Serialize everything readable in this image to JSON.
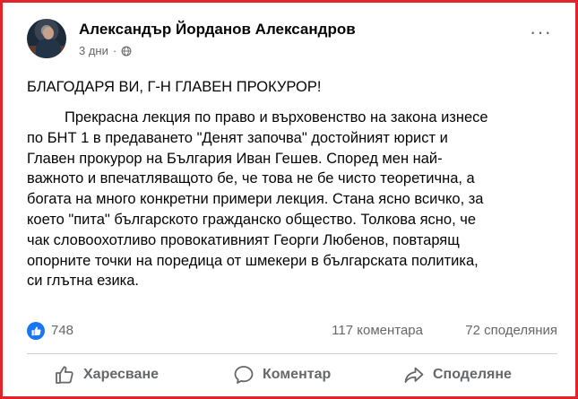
{
  "post": {
    "author": "Александър Йорданов Александров",
    "time": "3 дни",
    "separator": "·",
    "headline": "БЛАГОДАРЯ ВИ, Г-Н ГЛАВЕН ПРОКУРОР!",
    "lines": [
      "Прекрасна лекция по право и върховенство на закона изнесе",
      "по БНТ 1 в предаването \"Денят започва\" достойният юрист и",
      "Главен прокурор на България Иван Гешев. Според мен най-",
      "важното и впечатляващото бе, че това не бе чисто теоретична, а",
      "богата на много конкретни примери лекция. Стана ясно всичко, за",
      "което \"пита\" българското гражданско общество. Толкова ясно, че",
      "чак словоохотливо провокативният Георги Любенов, повтарящ",
      "опорните точки на поредица от шмекери в българската политика,",
      "си глътна езика."
    ]
  },
  "stats": {
    "reactions": "748",
    "comments": "117 коментара",
    "shares": "72 споделяния"
  },
  "actions": {
    "like": "Харесване",
    "comment": "Коментар",
    "share": "Споделяне"
  },
  "colors": {
    "frame": "#e0242b",
    "like_badge": "#1877f2",
    "muted_text": "#65676b"
  },
  "icons": [
    "more-options-icon",
    "globe-icon",
    "like-reaction-icon",
    "thumbs-up-icon",
    "comment-icon",
    "share-icon"
  ]
}
